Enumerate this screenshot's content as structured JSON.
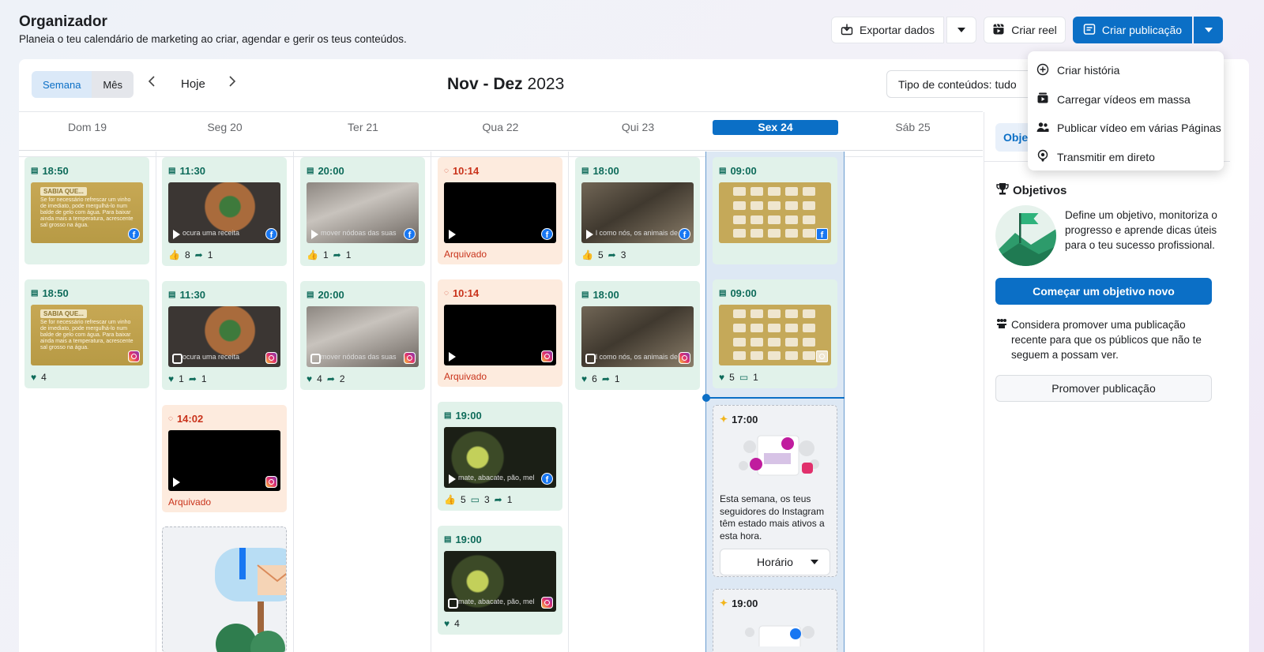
{
  "header": {
    "title": "Organizador",
    "subtitle": "Planeia o teu calendário de marketing ao criar, agendar e gerir os teus conteúdos.",
    "export_label": "Exportar dados",
    "reel_label": "Criar reel",
    "create_post_label": "Criar publicação"
  },
  "dropdown": {
    "items": [
      {
        "label": "Criar história",
        "icon": "plus-circle-icon"
      },
      {
        "label": "Carregar vídeos em massa",
        "icon": "video-stack-icon"
      },
      {
        "label": "Publicar vídeo em várias Páginas",
        "icon": "people-icon"
      },
      {
        "label": "Transmitir em direto",
        "icon": "live-icon"
      }
    ]
  },
  "toolbar": {
    "week_label": "Semana",
    "month_label": "Mês",
    "today_label": "Hoje",
    "range_label": "Nov - Dez",
    "range_year": "2023",
    "content_type_label": "Tipo de conteúdos: tudo"
  },
  "days": [
    "Dom 19",
    "Seg 20",
    "Ter 21",
    "Qua 22",
    "Qui 23",
    "Sex 24",
    "Sáb 25"
  ],
  "cards": {
    "sun1": {
      "time": "18:50",
      "tag": "SABIA QUE...",
      "text": "Se for necessário refrescar um vinho de imediato, pode mergulhá-lo num balde de gelo com água. Para baixar ainda mais a temperatura, acrescente sal grosso na água."
    },
    "sun2": {
      "time": "18:50",
      "tag": "SABIA QUE...",
      "text": "Se for necessário refrescar um vinho de imediato, pode mergulhá-lo num balde de gelo com água. Para baixar ainda mais a temperatura, acrescente sal grosso na água.",
      "likes": "4"
    },
    "mon1": {
      "time": "11:30",
      "overlay": "ocura uma receita",
      "likes": "8",
      "shares": "1"
    },
    "mon2": {
      "time": "11:30",
      "overlay": "ocura uma receita",
      "likes": "1",
      "shares": "1"
    },
    "mon3": {
      "time": "14:02",
      "status": "Arquivado"
    },
    "tue1": {
      "time": "20:00",
      "overlay": "mover nódoas das suas",
      "likes": "1",
      "shares": "1"
    },
    "tue2": {
      "time": "20:00",
      "overlay": "mover nódoas das suas",
      "likes": "4",
      "shares": "2"
    },
    "wed1": {
      "time": "10:14",
      "status": "Arquivado"
    },
    "wed2": {
      "time": "10:14",
      "status": "Arquivado"
    },
    "wed3": {
      "time": "19:00",
      "overlay": "mate, abacate, pão, mel",
      "likes": "5",
      "comments": "3",
      "shares": "1"
    },
    "wed4": {
      "time": "19:00",
      "overlay": "mate, abacate, pão, mel",
      "likes": "4"
    },
    "thu1": {
      "time": "18:00",
      "overlay": "l como nós, os animais de",
      "likes": "5",
      "shares": "3"
    },
    "thu2": {
      "time": "18:00",
      "overlay": "l como nós, os animais de",
      "likes": "6",
      "shares": "1"
    },
    "fri1": {
      "time": "09:00"
    },
    "fri2": {
      "time": "09:00",
      "likes": "5",
      "comments": "1"
    },
    "fri3": {
      "time": "17:00",
      "text": "Esta semana, os teus seguidores do Instagram têm estado mais ativos a esta hora.",
      "button": "Horário"
    },
    "fri4": {
      "time": "19:00"
    }
  },
  "sidebar": {
    "tab_label": "Obje",
    "objectives_title": "Objetivos",
    "objectives_text": "Define um objetivo, monitoriza o progresso e aprende dicas úteis para o teu sucesso profissional.",
    "start_objective_label": "Começar um objetivo novo",
    "promote_text": "Considera promover uma publicação recente para que os públicos que não te seguem a possam ver.",
    "promote_button_label": "Promover publicação"
  },
  "colors": {
    "brand_blue": "#0b6fc6",
    "published_green": "#e1f2ea",
    "archived_orange": "#fdebde"
  }
}
